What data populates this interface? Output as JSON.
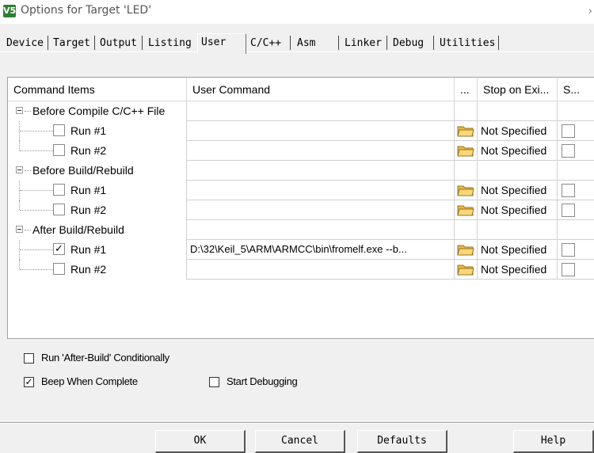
{
  "window": {
    "title": "Options for Target 'LED'",
    "app_icon_text": "V5"
  },
  "tabs": [
    "Device",
    "Target",
    "Output",
    "Listing",
    "User",
    "C/C++",
    "Asm",
    "Linker",
    "Debug",
    "Utilities"
  ],
  "active_tab": "User",
  "grid": {
    "headers": {
      "command_items": "Command Items",
      "user_command": "User Command",
      "browse": "...",
      "stop_on_exit": "Stop on Exi...",
      "s": "S..."
    },
    "groups": [
      {
        "label": "Before Compile C/C++ File",
        "rows": [
          {
            "label": "Run #1",
            "checked": false,
            "command": "",
            "stop": "Not Specified"
          },
          {
            "label": "Run #2",
            "checked": false,
            "command": "",
            "stop": "Not Specified"
          }
        ]
      },
      {
        "label": "Before Build/Rebuild",
        "rows": [
          {
            "label": "Run #1",
            "checked": false,
            "command": "",
            "stop": "Not Specified"
          },
          {
            "label": "Run #2",
            "checked": false,
            "command": "",
            "stop": "Not Specified"
          }
        ]
      },
      {
        "label": "After Build/Rebuild",
        "rows": [
          {
            "label": "Run #1",
            "checked": true,
            "command": "D:\\32\\Keil_5\\ARM\\ARMCC\\bin\\fromelf.exe  --b...",
            "stop": "Not Specified"
          },
          {
            "label": "Run #2",
            "checked": false,
            "command": "",
            "stop": "Not Specified"
          }
        ]
      }
    ]
  },
  "options": {
    "run_after_build_conditionally": {
      "label": "Run 'After-Build' Conditionally",
      "checked": false
    },
    "beep_when_complete": {
      "label": "Beep When Complete",
      "checked": true
    },
    "start_debugging": {
      "label": "Start Debugging",
      "checked": false
    }
  },
  "buttons": {
    "ok": "OK",
    "cancel": "Cancel",
    "defaults": "Defaults",
    "help": "Help"
  },
  "colors": {
    "background": "#f0f0f0",
    "grid_background": "#ffffff",
    "folder_icon": "#d9a441"
  },
  "icons": {
    "app": "keil-uvision-icon",
    "tree_expander": "minus-box-icon",
    "browse": "folder-open-icon"
  }
}
